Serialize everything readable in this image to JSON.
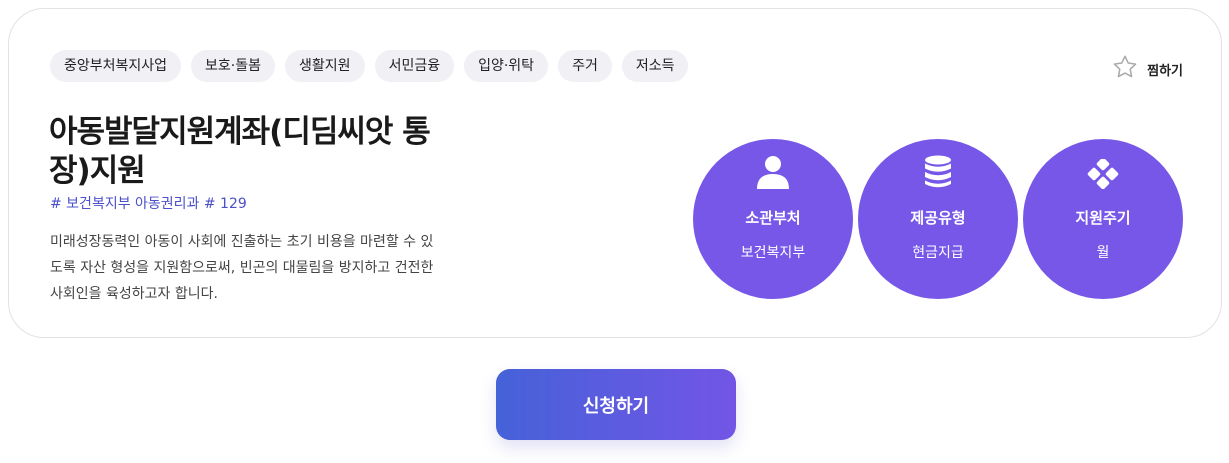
{
  "tags": [
    "중앙부처복지사업",
    "보호·돌봄",
    "생활지원",
    "서민금융",
    "입양·위탁",
    "주거",
    "저소득"
  ],
  "favorite": {
    "label": "찜하기",
    "icon": "star-outline-icon"
  },
  "program": {
    "title": "아동발달지원계좌(디딤씨앗 통장)지원",
    "meta": "# 보건복지부 아동권리과 # 129",
    "description": "미래성장동력인 아동이 사회에 진출하는 초기 비용을 마련할 수 있도록 자산 형성을   지원함으로써, 빈곤의 대물림을 방지하고 건전한 사회인을 육성하고자 합니다."
  },
  "info": [
    {
      "label": "소관부처",
      "value": "보건복지부",
      "icon": "person-icon"
    },
    {
      "label": "제공유형",
      "value": "현금지급",
      "icon": "database-icon"
    },
    {
      "label": "지원주기",
      "value": "월",
      "icon": "four-dots-icon"
    }
  ],
  "apply_button": {
    "label": "신청하기"
  },
  "colors": {
    "accent": "#7657e8",
    "button_start": "#4562d8",
    "button_end": "#7355e6",
    "meta": "#4b50c8"
  }
}
